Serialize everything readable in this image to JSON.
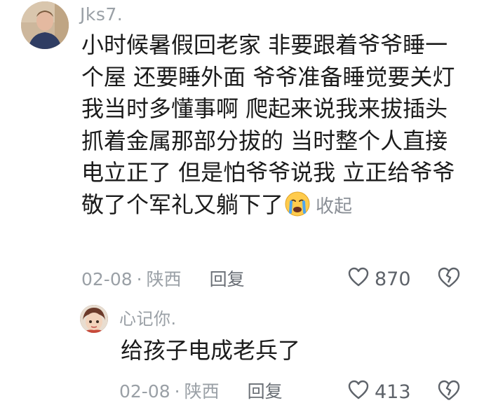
{
  "comment": {
    "username": "Jks7.",
    "lines": [
      "小时候暑假回老家 非要跟着爷爷睡一",
      "个屋 还要睡外面 爷爷准备睡觉要关灯",
      "我当时多懂事啊 爬起来说我来拔插头",
      "抓着金属那部分拔的 当时整个人直接",
      "电立正了 但是怕爷爷说我 立正给爷爷",
      "敬了个军礼又躺下了"
    ],
    "emoji": "crying-face-emoji",
    "collapse_label": "收起",
    "date": "02-08",
    "location": "陕西",
    "reply_label": "回复",
    "like_count": "870"
  },
  "reply": {
    "username": "心记你.",
    "text": "给孩子电成老兵了",
    "date": "02-08",
    "location": "陕西",
    "reply_label": "回复",
    "like_count": "413"
  },
  "colors": {
    "meta_gray": "#9aa0a6",
    "text_dark": "#1b1b1b",
    "icon_gray": "#5e636a"
  }
}
